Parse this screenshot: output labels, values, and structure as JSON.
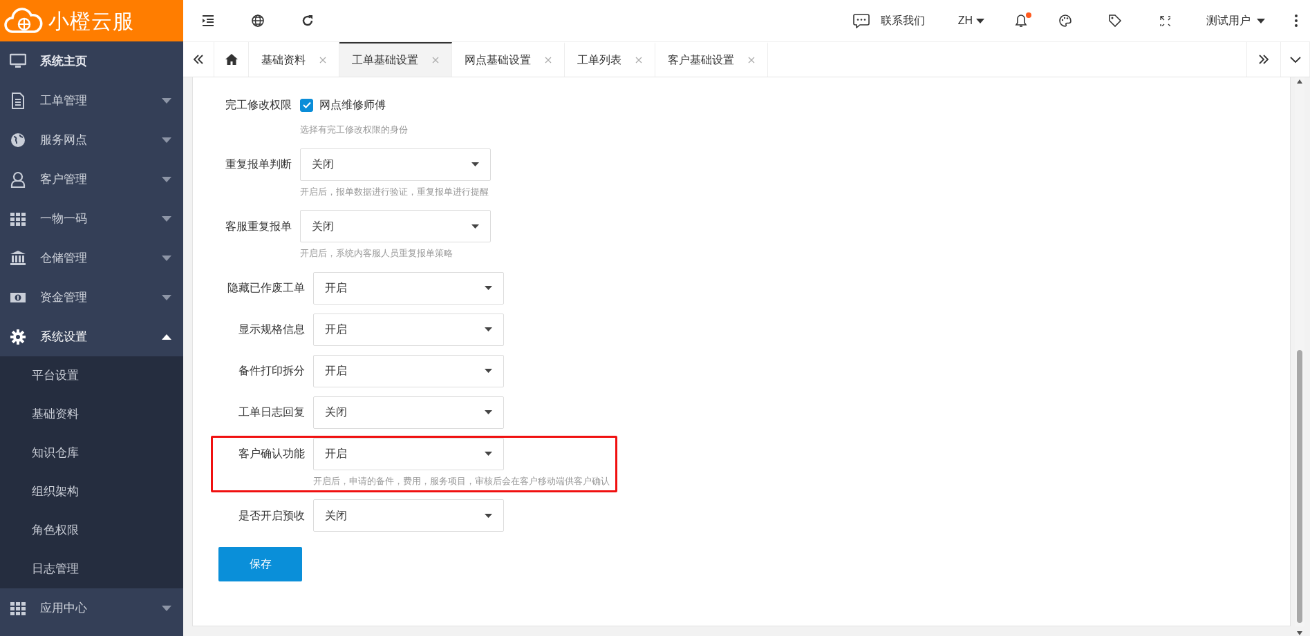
{
  "logo": {
    "text": "小橙云服"
  },
  "header": {
    "contact": "联系我们",
    "language": "ZH",
    "notification_dot": true,
    "user": "测试用户"
  },
  "tabs": [
    {
      "label": "基础资料",
      "selected": false
    },
    {
      "label": "工单基础设置",
      "selected": true
    },
    {
      "label": "网点基础设置",
      "selected": false
    },
    {
      "label": "工单列表",
      "selected": false
    },
    {
      "label": "客户基础设置",
      "selected": false
    }
  ],
  "sidebar": {
    "items": [
      {
        "kind": "monitor",
        "label": "系统主页"
      },
      {
        "kind": "document",
        "label": "工单管理",
        "expanded": false
      },
      {
        "kind": "globe",
        "label": "服务网点",
        "expanded": false
      },
      {
        "kind": "user",
        "label": "客户管理",
        "expanded": false
      },
      {
        "kind": "grid",
        "label": "一物一码",
        "expanded": false
      },
      {
        "kind": "bank",
        "label": "仓储管理",
        "expanded": false
      },
      {
        "kind": "money",
        "label": "资金管理",
        "expanded": false
      },
      {
        "kind": "gear",
        "label": "系统设置",
        "expanded": true,
        "children": [
          {
            "label": "平台设置"
          },
          {
            "label": "基础资料"
          },
          {
            "label": "知识仓库"
          },
          {
            "label": "组织架构"
          },
          {
            "label": "角色权限"
          },
          {
            "label": "日志管理"
          }
        ]
      },
      {
        "kind": "grid",
        "label": "应用中心",
        "expanded": false
      }
    ]
  },
  "form": {
    "fields": [
      {
        "kind": "checkbox",
        "label": "完工修改权限",
        "options": [
          {
            "label": "网点维修师傅",
            "checked": true
          }
        ],
        "hint": "选择有完工修改权限的身份",
        "highlighted": false
      },
      {
        "kind": "select",
        "label": "重复报单判断",
        "value": "关闭",
        "hint": "开启后，报单数据进行验证，重复报单进行提醒",
        "highlighted": false
      },
      {
        "kind": "select",
        "label": "客服重复报单",
        "value": "关闭",
        "hint": "开启后，系统内客服人员重复报单策略",
        "highlighted": false
      },
      {
        "kind": "select",
        "label": "隐藏已作废工单",
        "value": "开启",
        "highlighted": false
      },
      {
        "kind": "select",
        "label": "显示规格信息",
        "value": "开启",
        "highlighted": false
      },
      {
        "kind": "select",
        "label": "备件打印拆分",
        "value": "开启",
        "highlighted": false
      },
      {
        "kind": "select",
        "label": "工单日志回复",
        "value": "关闭",
        "highlighted": false
      },
      {
        "kind": "select",
        "label": "客户确认功能",
        "value": "开启",
        "hint": "开启后，申请的备件，费用，服务项目，审核后会在客户移动端供客户确认",
        "highlighted": true
      },
      {
        "kind": "select",
        "label": "是否开启预收",
        "value": "关闭",
        "highlighted": false
      }
    ],
    "save_button": "保存"
  }
}
